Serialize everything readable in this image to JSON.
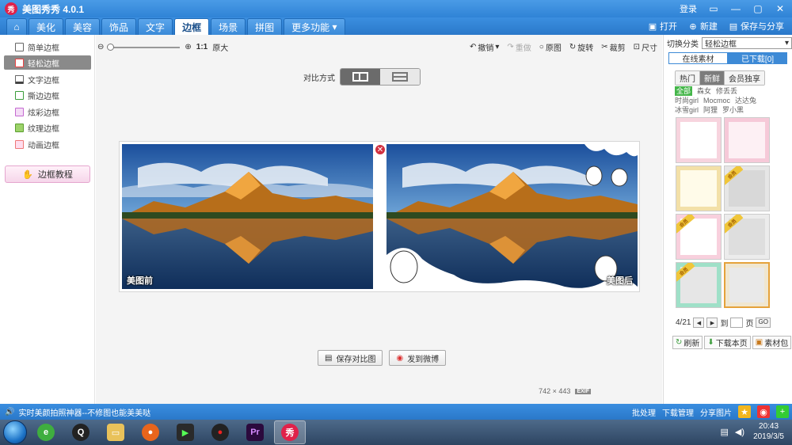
{
  "app": {
    "logo": "秀",
    "title": "美图秀秀 4.0.1",
    "login": "登录"
  },
  "menu": {
    "tabs": [
      "美化",
      "美容",
      "饰品",
      "文字",
      "边框",
      "场景",
      "拼图",
      "更多功能"
    ],
    "active": "边框",
    "right": {
      "open": "打开",
      "new": "新建",
      "save_share": "保存与分享"
    }
  },
  "sidebar": {
    "items": [
      "简单边框",
      "轻松边框",
      "文字边框",
      "撕边边框",
      "炫彩边框",
      "纹理边框",
      "动画边框"
    ],
    "active_index": 1,
    "tutorial": "边框教程"
  },
  "zoom": {
    "ratio": "1:1",
    "original": "原大"
  },
  "edit_tools": {
    "undo": "撤销",
    "redo": "重做",
    "original": "原图",
    "rotate": "旋转",
    "crop": "裁剪",
    "size": "尺寸"
  },
  "compare": {
    "label": "对比方式"
  },
  "photos": {
    "before": "美图前",
    "after": "美图后"
  },
  "buttons": {
    "save_compare": "保存对比图",
    "send_weibo": "发到微博"
  },
  "image_info": {
    "size": "742 × 443",
    "exif": "EXIF"
  },
  "right_panel": {
    "switch_label": "切换分类",
    "switch_value": "轻松边框",
    "tabs": [
      "在线素材",
      "已下载[0]"
    ],
    "filters": [
      "热门",
      "新鲜",
      "会员独享"
    ],
    "active_filter": "新鲜",
    "categories": [
      [
        "全部",
        "森女",
        "修丢丢"
      ],
      [
        "时尚girl",
        "Mocmoc",
        "达达兔"
      ],
      [
        "冰雪girl",
        "阿狸",
        "罗小黑"
      ]
    ],
    "vip_label": "会员",
    "pager": {
      "page": "4/21",
      "goto": "到",
      "page_unit": "页",
      "go": "GO"
    },
    "actions": [
      "刷新",
      "下载本页",
      "素材包"
    ]
  },
  "statusbar": {
    "tip": "实时美颜拍照神器--不修图也能美美哒",
    "batch": "批处理",
    "download_mgr": "下载管理",
    "share_pic": "分享图片"
  },
  "taskbar": {
    "time": "20:43",
    "date": "2019/3/5"
  },
  "colors": {
    "titlebar": "#2f83d6",
    "accent": "#3d8ad6",
    "vip": "#f0c63a",
    "close": "#d03040"
  }
}
